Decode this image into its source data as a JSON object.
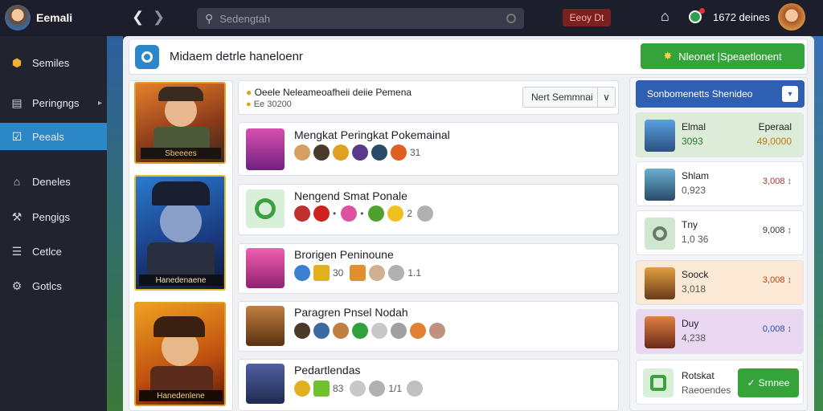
{
  "topbar": {
    "account_name": "Eemali",
    "search_placeholder": "Sedengtah",
    "red_badge": "Eeoy Dt",
    "status_text": "1672 deines"
  },
  "sidebar": {
    "items": [
      {
        "label": "Semiles",
        "icon": "coin-icon"
      },
      {
        "label": "Peringngs",
        "icon": "folder-icon"
      },
      {
        "label": "Peeals",
        "icon": "check-icon"
      },
      {
        "label": "Deneles",
        "icon": "home-icon"
      },
      {
        "label": "Pengigs",
        "icon": "tools-icon"
      },
      {
        "label": "Cetlce",
        "icon": "list-icon"
      },
      {
        "label": "Gotlcs",
        "icon": "settings-icon"
      }
    ],
    "active_index": 2
  },
  "header": {
    "title": "Midaem detrle haneloenr",
    "green_button": "Nleonet |Speaetlonent"
  },
  "filter": {
    "title_line1": "Oeele Neleameoafheii deiie Pemena",
    "title_line2": "Ee 30200",
    "select_value": "Nert Semmnai"
  },
  "posters": [
    {
      "label": "Sbeeees"
    },
    {
      "label": "Hanedenaene"
    },
    {
      "label": "Hanedenlene"
    }
  ],
  "rows": [
    {
      "title": "Mengkat Peringkat Pokemainal",
      "count": "31"
    },
    {
      "title": "Nengend Smat Ponale",
      "count": "2"
    },
    {
      "title": "Brorigen Peninoune",
      "count": "1.1",
      "extra": "30"
    },
    {
      "title": "Paragren Pnsel Nodah",
      "count": ""
    },
    {
      "title": "Pedartlendas",
      "count": "1/1",
      "extra": "83"
    }
  ],
  "right_panel": {
    "dropdown_label": "Sonbomenetts Shenideo",
    "cards": [
      {
        "name": "Elmal",
        "sub": "3093",
        "value_label": "Eperaal",
        "value": "49,0000",
        "bg": "#dcecd8"
      },
      {
        "name": "Shlam",
        "sub": "0,923",
        "value": "3,008"
      },
      {
        "name": "Tny",
        "sub": "1,0 36",
        "value": "9,008"
      },
      {
        "name": "Soock",
        "sub": "3,018",
        "value": "3,008",
        "bg": "#fbe9d6"
      },
      {
        "name": "Duy",
        "sub": "4,238",
        "value": "0,008",
        "bg": "#ead8f3"
      }
    ],
    "bottom_card": {
      "name": "Rotskat",
      "sub": "Raeoendes",
      "button": "Srnnee"
    }
  },
  "colors": {
    "accent": "#2b87c8",
    "green": "#34a43a",
    "primary_blue": "#2f5fb3",
    "red_badge": "#7a2020"
  }
}
